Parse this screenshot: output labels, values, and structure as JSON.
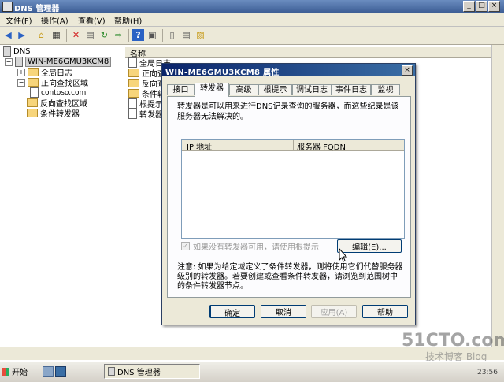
{
  "window": {
    "title": "DNS 管理器"
  },
  "menu": [
    "文件(F)",
    "操作(A)",
    "查看(V)",
    "帮助(H)"
  ],
  "tree": {
    "root": "DNS",
    "server": "WIN-ME6GMU3KCM8",
    "items": [
      "全局日志",
      "正向查找区域",
      "contoso.com",
      "反向查找区域",
      "条件转发器"
    ]
  },
  "list": {
    "header": "名称",
    "rows": [
      "全局日志",
      "正向查",
      "反向查",
      "条件转",
      "根提示",
      "转发器"
    ]
  },
  "dialog": {
    "title": "WIN-ME6GMU3KCM8 属性",
    "tabs": [
      "接口",
      "转发器",
      "高级",
      "根提示",
      "调试日志",
      "事件日志",
      "监视"
    ],
    "active_tab": "转发器",
    "description": "转发器是可以用来进行DNS记录查询的服务器，而这些纪录是该服务器无法解决的。",
    "columns": [
      "IP 地址",
      "服务器 FQDN"
    ],
    "checkbox_label": "如果没有转发器可用，请使用根提示",
    "edit_button": "编辑(E)...",
    "note": "注意: 如果为给定域定义了条件转发器，则将使用它们代替服务器级别的转发器。若要创建或查看条件转发器，请浏览到范围树中的条件转发器节点。",
    "buttons": {
      "ok": "确定",
      "cancel": "取消",
      "apply": "应用(A)",
      "help": "帮助"
    }
  },
  "taskbar": {
    "start": "开始",
    "task": "DNS 管理器",
    "clock": "23:56"
  },
  "watermark": {
    "line1": "51CTO.com",
    "line2": "技术博客 Blog"
  }
}
